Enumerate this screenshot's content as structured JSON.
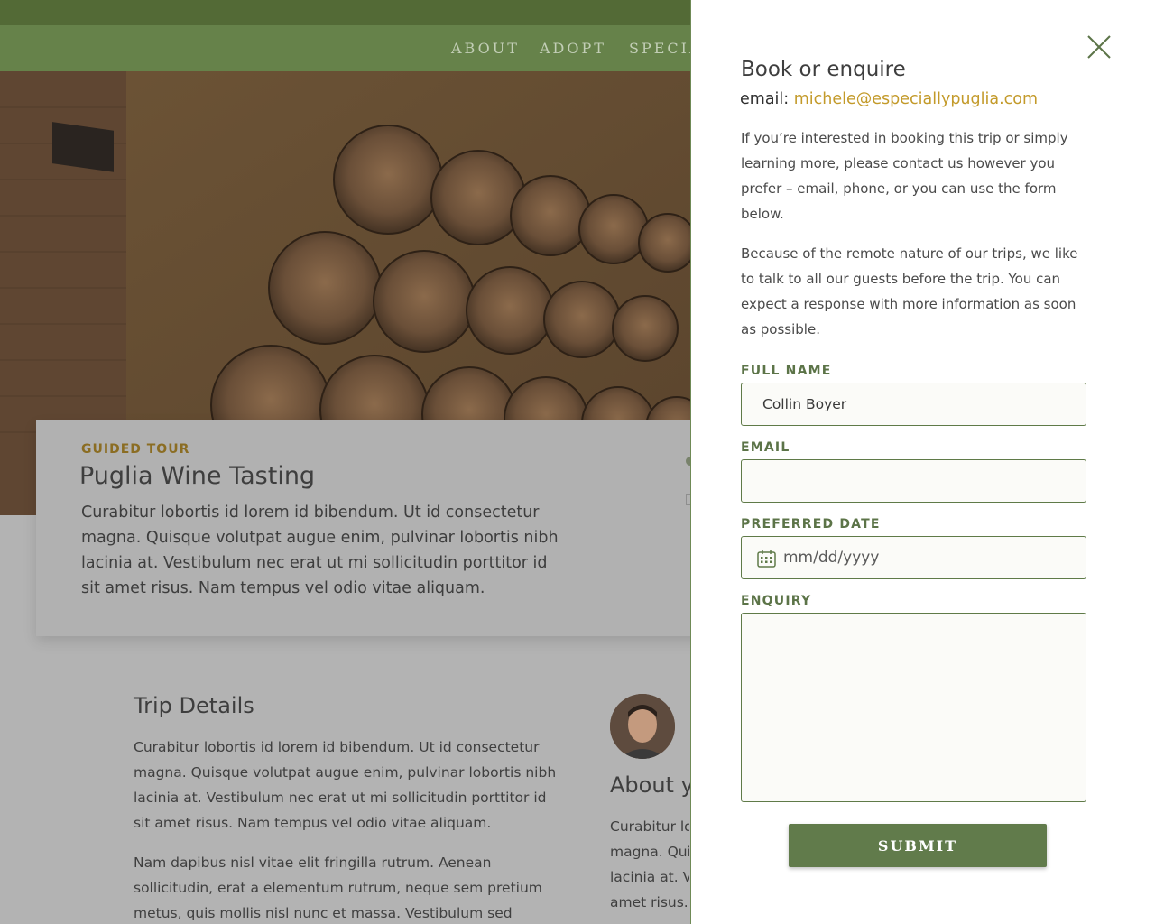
{
  "nav": {
    "items": [
      "ABOUT",
      "ADOPT",
      "SPECIA"
    ]
  },
  "card": {
    "tag": "GUIDED TOUR",
    "title": "Puglia Wine Tasting",
    "text": "Curabitur lobortis id lorem id bibendum. Ut id consectetur magna. Quisque volutpat augue enim, pulvinar lobortis nibh lacinia at. Vestibulum nec erat ut mi sollicitudin porttitor id sit amet risus. Nam tempus vel odio vitae aliquam."
  },
  "trip": {
    "title": "Trip Details",
    "p1": "Curabitur lobortis id lorem id bibendum. Ut id consectetur magna. Quisque volutpat augue enim, pulvinar lobortis nibh lacinia at. Vestibulum nec erat ut mi sollicitudin porttitor id sit amet risus. Nam tempus vel odio vitae aliquam.",
    "p2": "Nam dapibus nisl vitae elit fringilla rutrum. Aenean sollicitudin, erat a elementum rutrum, neque sem pretium metus, quis mollis nisl nunc et massa. Vestibulum sed metus in"
  },
  "about": {
    "title": "About yo",
    "lines": [
      "Curabitur lo",
      "magna. Quis",
      "lacinia at. Ve",
      "amet risus. N"
    ]
  },
  "panel": {
    "title": "Book or enquire",
    "email_label": "email:",
    "email": "michele@especiallypuglia.com",
    "p1": "If you’re interested in booking this trip or simply learning more,  please contact us however you prefer – email, phone, or you can use the form below.",
    "p2": "Because of the remote nature of our trips, we like to talk to all our guests before the trip. You can expect a response with more information as soon as possible.",
    "form": {
      "full_name_label": "FULL NAME",
      "full_name_value": "Collin Boyer",
      "email_label": "EMAIL",
      "email_value": "",
      "date_label": "PREFERRED DATE",
      "date_placeholder": "mm/dd/yyyy",
      "enquiry_label": "ENQUIRY",
      "enquiry_value": "",
      "submit_label": "SUBMIT"
    }
  },
  "colors": {
    "topbar": "#536a36",
    "navbar": "#66824a",
    "accent_gold": "#c39a2a",
    "label_green": "#5c7448",
    "submit_bg": "#617b4b"
  },
  "icons": {
    "close": "close-icon",
    "calendar": "calendar-icon"
  }
}
